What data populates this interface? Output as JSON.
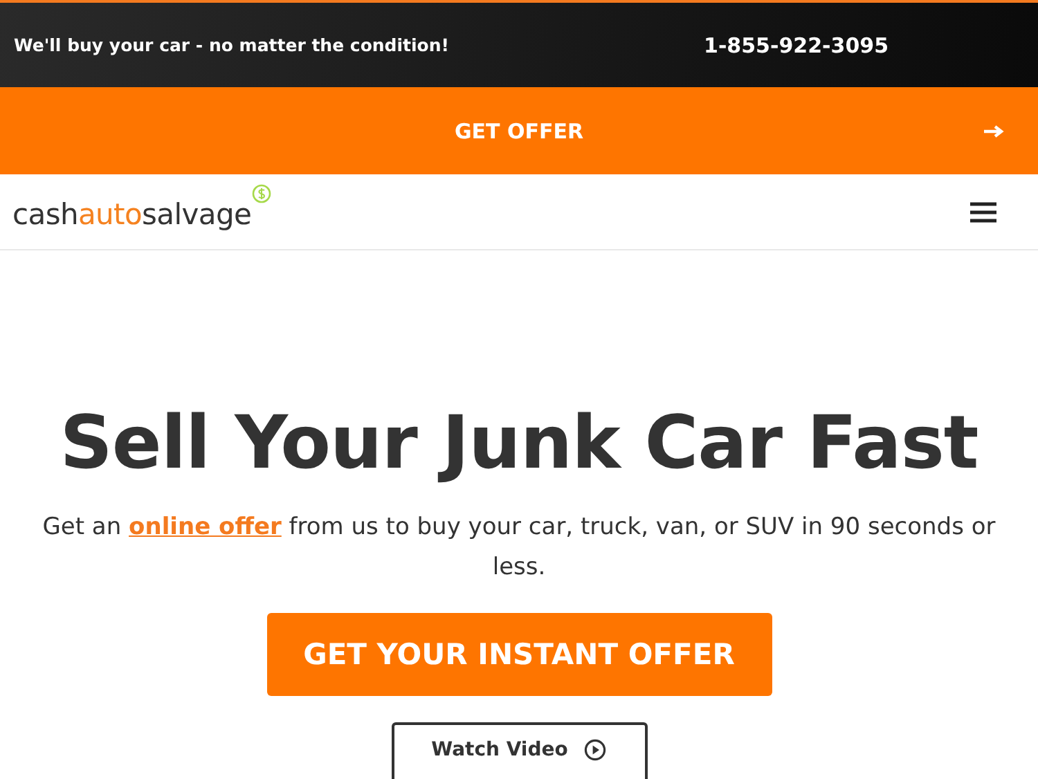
{
  "top_bar": {
    "tagline": "We'll buy your car - no matter the condition!",
    "phone": "1-855-922-3095"
  },
  "offer_bar": {
    "label": "GET OFFER"
  },
  "header": {
    "logo_parts": [
      {
        "text": "cash",
        "accent": false
      },
      {
        "text": "auto",
        "accent": true
      },
      {
        "text": "salvage",
        "accent": false
      }
    ]
  },
  "hero": {
    "heading": "Sell Your Junk Car Fast",
    "intro_before": "Get an",
    "intro_link": "online offer",
    "intro_after": "from us to buy your car, truck, van, or SUV in 90 seconds or less.",
    "primary_button": "GET YOUR INSTANT OFFER",
    "secondary_button": "Watch Video"
  }
}
